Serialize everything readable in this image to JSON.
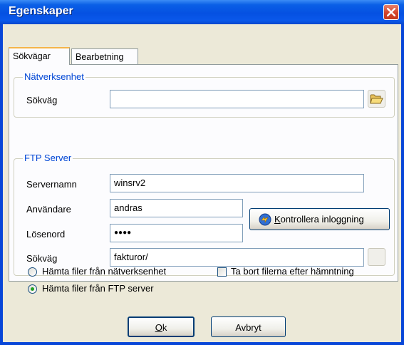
{
  "window": {
    "title": "Egenskaper"
  },
  "tabs": [
    {
      "label": "Sökvägar",
      "active": true
    },
    {
      "label": "Bearbetning",
      "active": false
    }
  ],
  "network": {
    "group_title": "Nätverksenhet",
    "path_label": "Sökväg",
    "path_value": ""
  },
  "ftp": {
    "group_title": "FTP Server",
    "server_label": "Servernamn",
    "server_value": "winsrv2",
    "user_label": "Användare",
    "user_value": "andras",
    "password_label": "Lösenord",
    "password_value": "●●●●",
    "path_label": "Sökväg",
    "path_value": "fakturor/",
    "check_login_prefix": "",
    "check_login_accel": "K",
    "check_login_rest": "ontrollera inloggning"
  },
  "options": {
    "radio_network_label": "Hämta filer från nätverksenhet",
    "radio_ftp_label": "Hämta filer från FTP server",
    "selected": "ftp",
    "delete_after_label": "Ta bort filerna efter hämntning",
    "delete_after_checked": false
  },
  "buttons": {
    "ok_accel": "O",
    "ok_rest": "k",
    "cancel": "Avbryt"
  },
  "colors": {
    "titlebar": "#0551e2",
    "group_title": "#0046d5",
    "dialog_bg": "#ece9d8",
    "radio_dot": "#21a121"
  }
}
